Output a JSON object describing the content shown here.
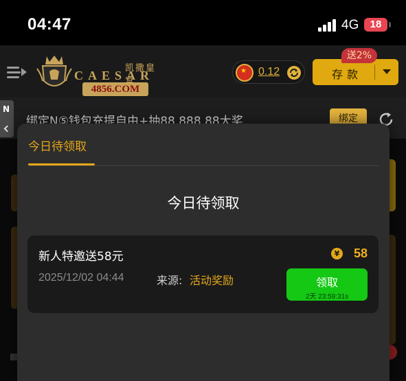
{
  "status_bar": {
    "time": "04:47",
    "network": "4G",
    "battery": "18"
  },
  "header": {
    "logo": {
      "cn_name": "凯撒皇宫",
      "brand": "CAESAR",
      "domain": "4856.COM"
    },
    "balance": "0.12",
    "deposit_label": "存款",
    "promo_badge": "送2%"
  },
  "notice": {
    "tab_label": "N",
    "text": "绑定N⑤钱包充提自由+抽88,888.88大奖",
    "bind_label": "绑定"
  },
  "modal": {
    "tab_label": "今日待领取",
    "title": "今日待领取",
    "reward": {
      "title": "新人特邀送58元",
      "amount": "58",
      "coin_symbol": "¥",
      "timestamp": "2025/12/02 04:44",
      "source_label": "来源:",
      "source_value": "活动奖励",
      "claim_label": "领取",
      "countdown": "2天 23:59:31s"
    }
  },
  "colors": {
    "accent_gold": "#e3a81a",
    "claim_green": "#14c814",
    "badge_red": "#c4323a",
    "battery_red": "#e84652"
  },
  "icons": {
    "menu": "menu-arrow-icon",
    "flag": "china-flag-icon",
    "refresh": "refresh-icon",
    "dropdown": "chevron-down-icon",
    "coin": "yuan-coin-icon",
    "reload": "reload-icon"
  }
}
